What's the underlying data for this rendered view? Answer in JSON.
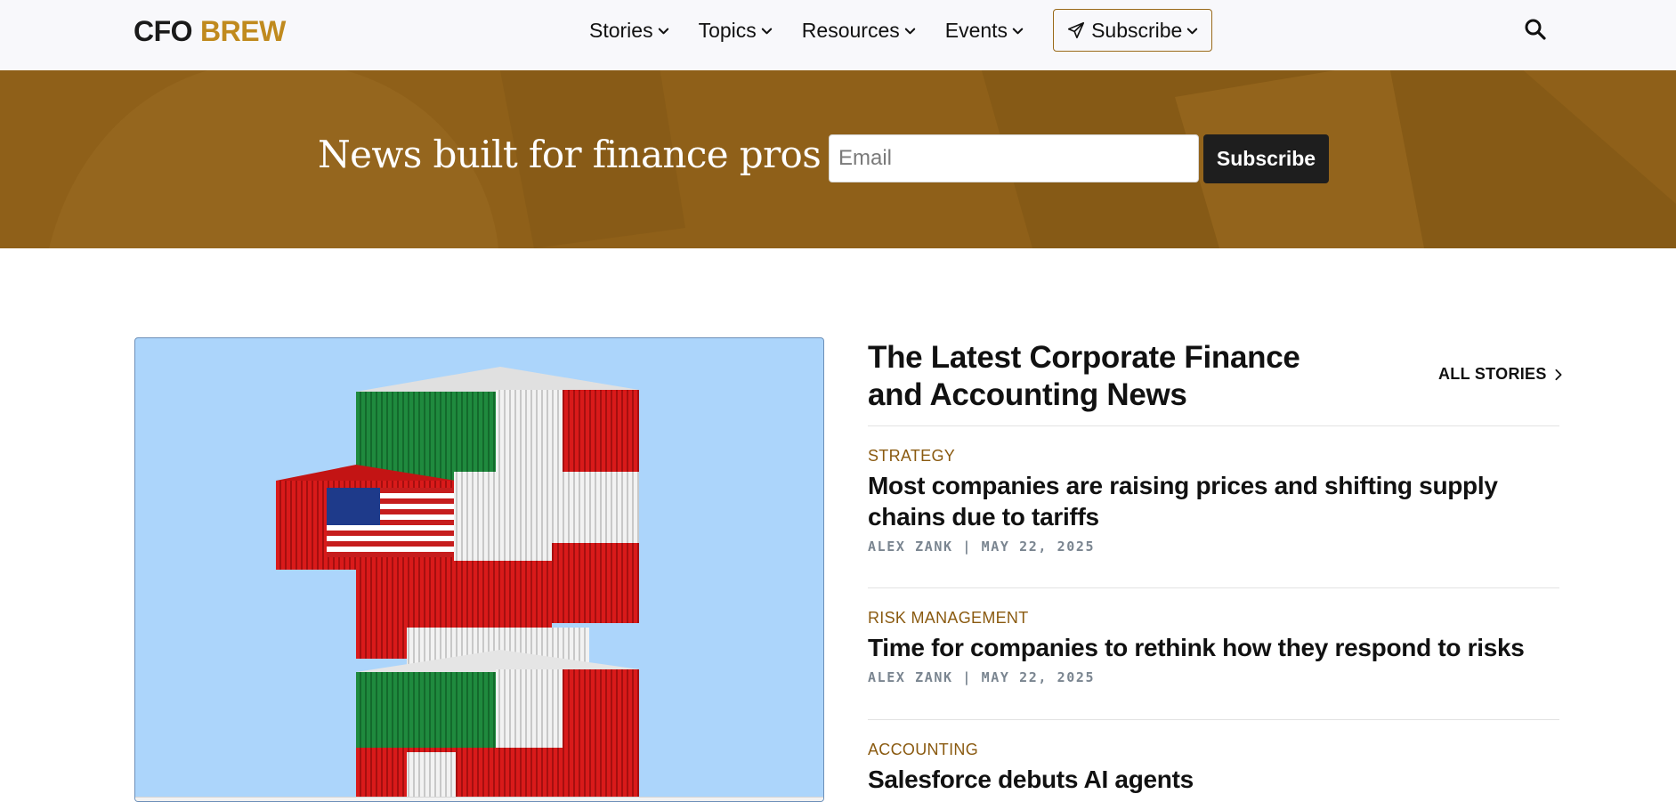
{
  "header": {
    "logo_part1": "CFO",
    "logo_part2": "BREW",
    "nav": [
      {
        "label": "Stories"
      },
      {
        "label": "Topics"
      },
      {
        "label": "Resources"
      },
      {
        "label": "Events"
      }
    ],
    "subscribe_label": "Subscribe",
    "search_icon": "search-icon"
  },
  "banner": {
    "title": "News built for finance pros",
    "email_placeholder": "Email",
    "subscribe_label": "Subscribe"
  },
  "latest": {
    "title": "The Latest Corporate Finance and Accounting News",
    "all_stories_label": "ALL STORIES",
    "articles": [
      {
        "category": "STRATEGY",
        "headline": "Most companies are raising prices and shifting supply chains due to tariffs",
        "author": "ALEX ZANK",
        "date": "MAY 22, 2025"
      },
      {
        "category": "RISK MANAGEMENT",
        "headline": "Time for companies to rethink how they respond to risks",
        "author": "ALEX ZANK",
        "date": "MAY 22, 2025"
      },
      {
        "category": "ACCOUNTING",
        "headline": "Salesforce debuts AI agents"
      }
    ]
  },
  "colors": {
    "brand_gold": "#c08a1e",
    "banner_bg": "#8f6019",
    "category": "#8a5a10",
    "hero_bg": "#acd5fb"
  }
}
